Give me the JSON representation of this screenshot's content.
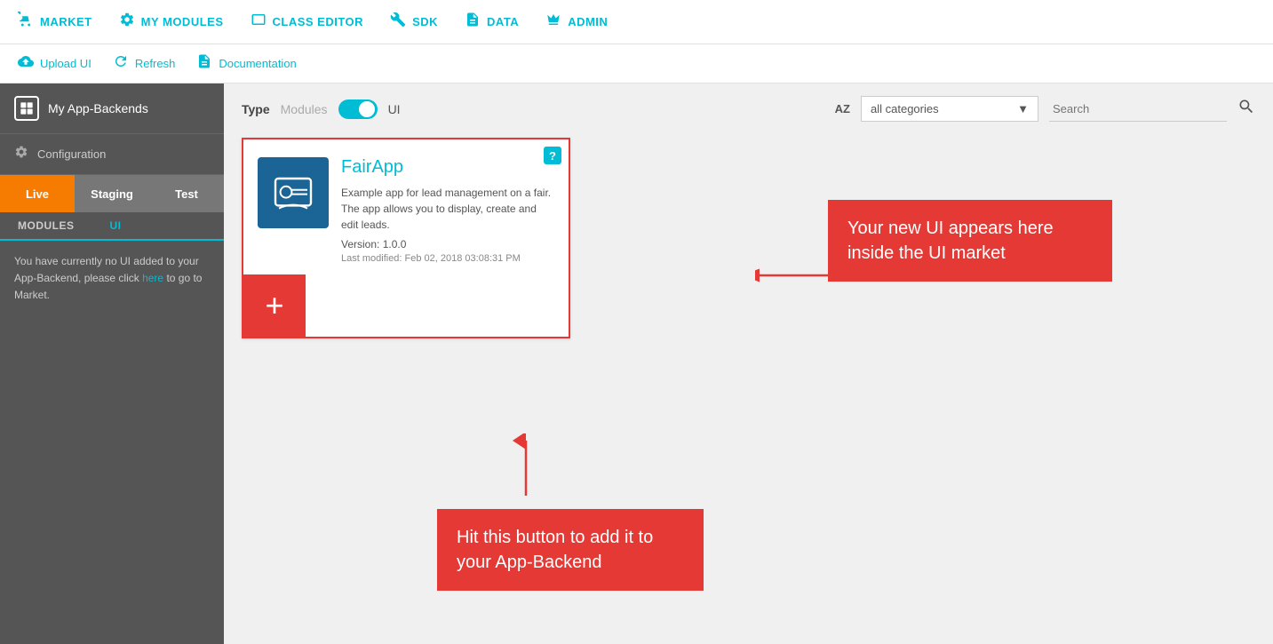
{
  "topNav": {
    "items": [
      {
        "id": "market",
        "label": "MARKET",
        "icon": "🛒"
      },
      {
        "id": "my-modules",
        "label": "MY MODULES",
        "icon": "⚙️"
      },
      {
        "id": "class-editor",
        "label": "CLASS EDITOR",
        "icon": "🖥"
      },
      {
        "id": "sdk",
        "label": "SDK",
        "icon": "🔧"
      },
      {
        "id": "data",
        "label": "DATA",
        "icon": "📄"
      },
      {
        "id": "admin",
        "label": "ADMIN",
        "icon": "👑"
      }
    ]
  },
  "subToolbar": {
    "items": [
      {
        "id": "upload-ui",
        "label": "Upload UI",
        "icon": "☁"
      },
      {
        "id": "refresh",
        "label": "Refresh",
        "icon": "🔄"
      },
      {
        "id": "documentation",
        "label": "Documentation",
        "icon": "📋"
      }
    ]
  },
  "sidebar": {
    "appTitle": "My App-Backends",
    "configLabel": "Configuration",
    "envTabs": [
      {
        "id": "live",
        "label": "Live",
        "active": true
      },
      {
        "id": "staging",
        "label": "Staging",
        "active": false
      },
      {
        "id": "test",
        "label": "Test",
        "active": false
      }
    ],
    "moduleTabs": [
      {
        "id": "modules",
        "label": "MODULES",
        "active": false
      },
      {
        "id": "ui",
        "label": "UI",
        "active": true
      }
    ],
    "infoText": "You have currently no UI added to your App-Backend, please click ",
    "infoLink": "here",
    "infoTextEnd": " to go to Market."
  },
  "typeBar": {
    "typeLabel": "Type",
    "modulesLabel": "Modules",
    "uiLabel": "UI"
  },
  "filterBar": {
    "categoryValue": "all categories",
    "searchPlaceholder": "Search"
  },
  "card": {
    "name": "FairApp",
    "description": "Example app for lead management on a fair. The app allows you to display, create and edit leads.",
    "version": "Version: 1.0.0",
    "lastModified": "Last modified: Feb 02, 2018 03:08:31 PM"
  },
  "callouts": {
    "right": "Your new UI appears here inside the UI market",
    "bottom": "Hit this button to add it to your App-Backend"
  },
  "colors": {
    "accent": "#00bcd4",
    "orange": "#f57c00",
    "red": "#e53935",
    "sidebarBg": "#555555"
  }
}
